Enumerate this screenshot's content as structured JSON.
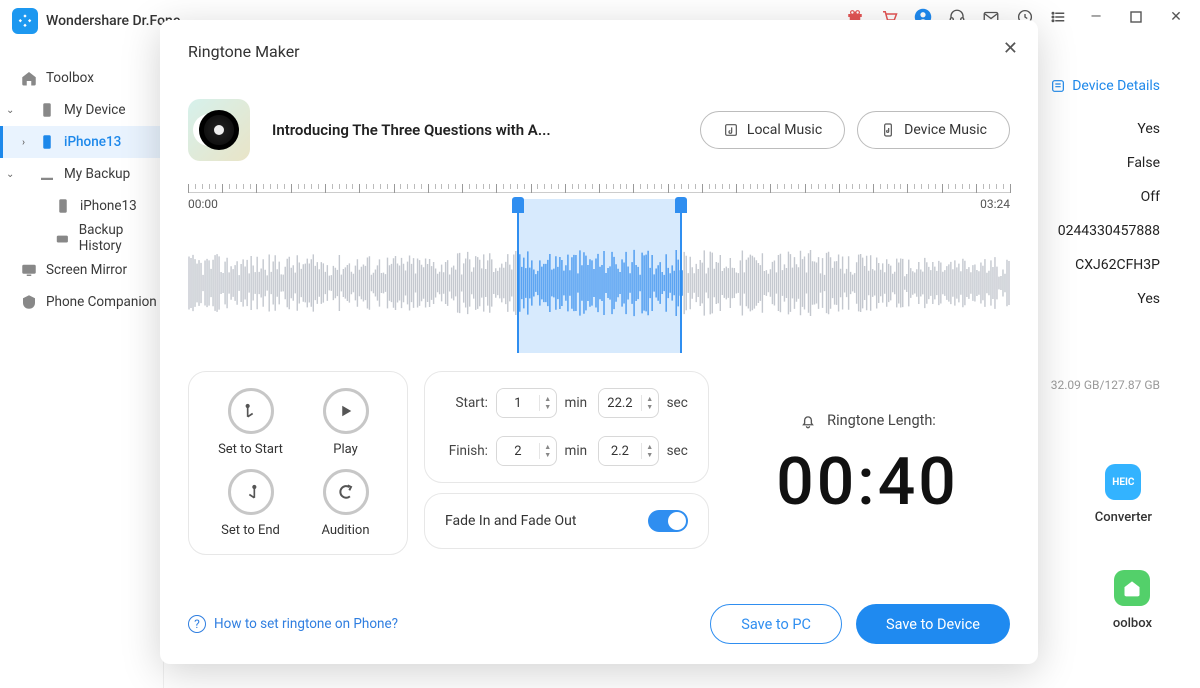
{
  "app": {
    "title": "Wondershare Dr.Fone"
  },
  "header_icons": [
    "gift",
    "cart",
    "user",
    "headset",
    "mail",
    "history",
    "list",
    "minimize",
    "maximize",
    "close"
  ],
  "sidebar": {
    "items": [
      {
        "label": "Toolbox"
      },
      {
        "label": "My Device",
        "expandable": true
      },
      {
        "label": "iPhone13",
        "active": true
      },
      {
        "label": "My Backup",
        "expandable": true
      },
      {
        "label": "iPhone13"
      },
      {
        "label": "Backup History"
      },
      {
        "label": "Screen Mirror"
      },
      {
        "label": "Phone Companion"
      }
    ]
  },
  "background": {
    "device_details_label": "Device Details",
    "values": [
      "Yes",
      "False",
      "Off",
      "0244330457888",
      "CXJ62CFH3P",
      "Yes"
    ],
    "storage": "32.09 GB/127.87 GB",
    "tile1": "Converter",
    "tile2": "oolbox"
  },
  "modal": {
    "title": "Ringtone Maker",
    "track": "Introducing The Three Questions with A...",
    "local_music": "Local Music",
    "device_music": "Device Music",
    "time_start_label": "00:00",
    "time_end_label": "03:24",
    "selection": {
      "start_pct": 40.2,
      "end_pct": 60.0
    },
    "controls": {
      "set_start": "Set to Start",
      "play": "Play",
      "set_end": "Set to End",
      "audition": "Audition"
    },
    "time_panel": {
      "start_label": "Start:",
      "finish_label": "Finish:",
      "start_min": "1",
      "start_sec": "22.2",
      "finish_min": "2",
      "finish_sec": "2.2",
      "unit_min": "min",
      "unit_sec": "sec"
    },
    "fade_label": "Fade In and Fade Out",
    "fade_on": true,
    "len_title": "Ringtone Length:",
    "len_value": "00:40",
    "help": "How to set ringtone on Phone?",
    "save_pc": "Save to PC",
    "save_device": "Save to Device"
  }
}
